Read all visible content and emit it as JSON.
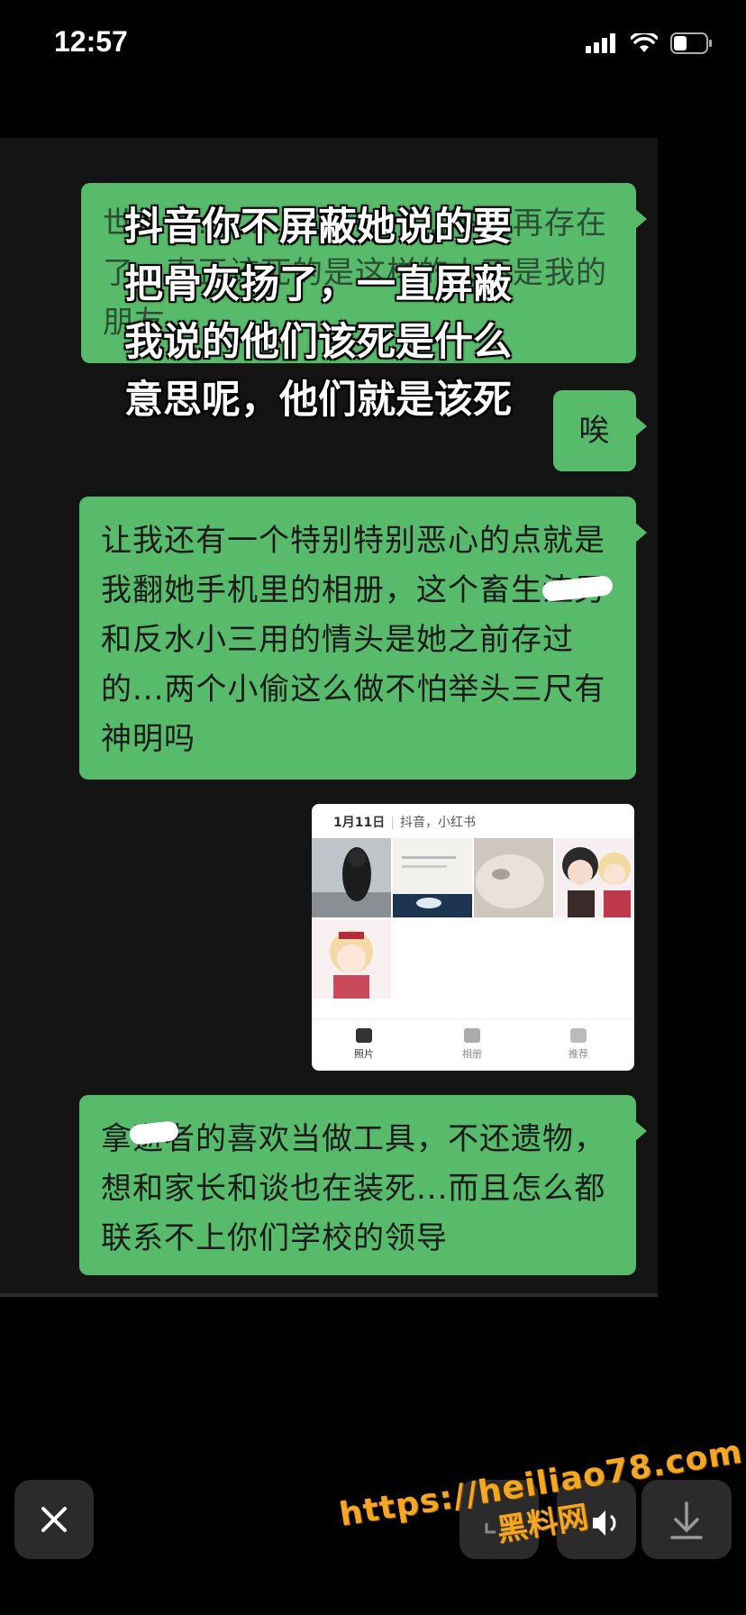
{
  "status_bar": {
    "time": "12:57"
  },
  "chat": {
    "bubble1_text": "世…………………………不要再存在了…真正该死的是这样的人不是我的朋友",
    "overlay_caption": "抖音你不屏蔽她说的要把骨灰扬了，一直屏蔽我说的他们该死是什么意思呢，他们就是该死",
    "bubble2_text": "唉",
    "bubble3_text": "让我还有一个特别特别恶心的点就是我翻她手机里的相册，这个畜生渣男和反水小三用的情头是她之前存过的...两个小偷这么做不怕举头三尺有神明吗",
    "bubble5_text": "拿逝者的喜欢当做工具，不还遗物，想和家长和谈也在装死...而且怎么都联系不上你们学校的领导"
  },
  "photo_card": {
    "date": "1月11日",
    "apps": "抖音，小红书",
    "tabs": [
      "照片",
      "相册",
      "推荐"
    ]
  },
  "watermark": {
    "url": "https://heiliao78.com",
    "name": "黑料网"
  },
  "icons": {
    "close": "close-icon",
    "speaker": "speaker-icon",
    "download": "download-icon"
  },
  "colors": {
    "bubble": "#58ba6b",
    "background": "#141414",
    "watermark": "#f5a623"
  }
}
